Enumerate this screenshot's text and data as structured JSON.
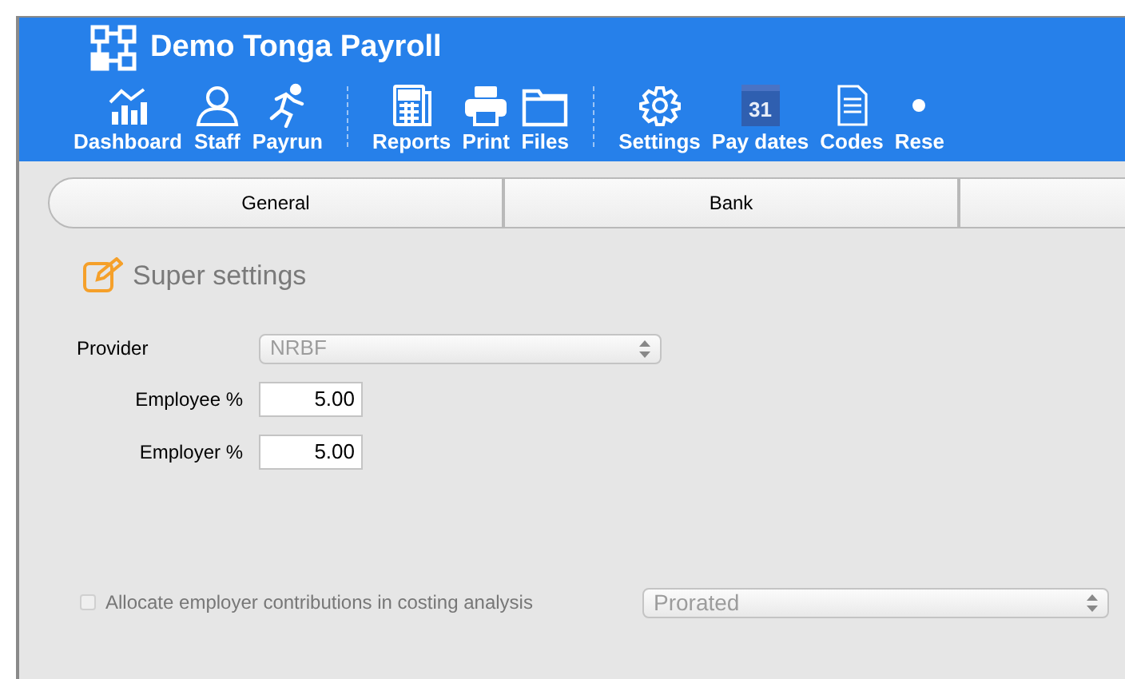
{
  "window": {
    "title": "Demo Tonga Payroll"
  },
  "toolbar": [
    {
      "kind": "button",
      "label": "Dashboard"
    },
    {
      "kind": "button",
      "label": "Staff"
    },
    {
      "kind": "button",
      "label": "Payrun"
    },
    {
      "kind": "separator"
    },
    {
      "kind": "button",
      "label": "Reports"
    },
    {
      "kind": "button",
      "label": "Print"
    },
    {
      "kind": "button",
      "label": "Files"
    },
    {
      "kind": "separator"
    },
    {
      "kind": "button",
      "label": "Settings"
    },
    {
      "kind": "button",
      "label": "Pay dates",
      "icon_text": "31"
    },
    {
      "kind": "button",
      "label": "Codes"
    },
    {
      "kind": "button",
      "label": "Rese"
    }
  ],
  "tabs": [
    {
      "label": "General",
      "selected": false
    },
    {
      "label": "Bank",
      "selected": false
    },
    {
      "selected": false
    }
  ],
  "section": {
    "title": "Super settings"
  },
  "provider": {
    "label": "Provider",
    "value": "NRBF",
    "disabled": true
  },
  "fields": [
    {
      "label": "Employee %",
      "value": "5.00"
    },
    {
      "label": "Employer %",
      "value": "5.00"
    }
  ],
  "allocate": {
    "label": "Allocate employer contributions in costing analysis",
    "checked": false,
    "disabled": true
  },
  "method": {
    "value": "Prorated",
    "disabled": true
  }
}
